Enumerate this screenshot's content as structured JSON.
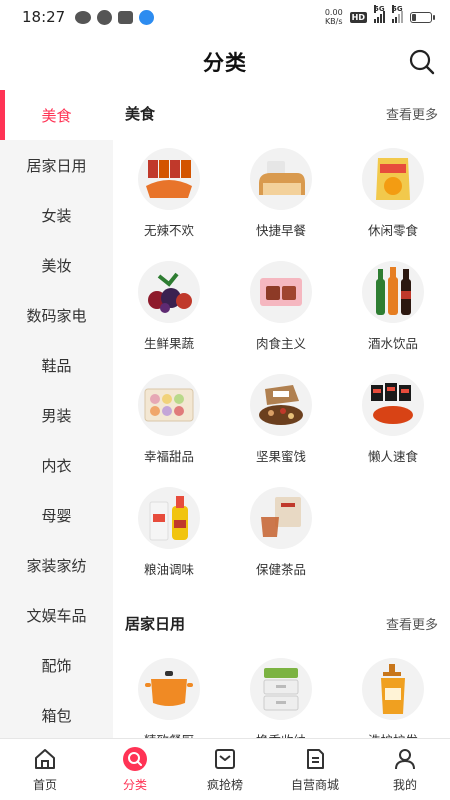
{
  "status_bar": {
    "time": "18:27",
    "net_speed_value": "0.00",
    "net_speed_unit": "KB/s",
    "hd_label": "HD",
    "signal1_label": "5G",
    "signal2_label": "5G",
    "battery_level": 0.25
  },
  "header": {
    "title": "分类",
    "search_icon": "search-icon"
  },
  "sidebar": {
    "active_index": 0,
    "items": [
      {
        "label": "美食"
      },
      {
        "label": "居家日用"
      },
      {
        "label": "女装"
      },
      {
        "label": "美妆"
      },
      {
        "label": "数码家电"
      },
      {
        "label": "鞋品"
      },
      {
        "label": "男装"
      },
      {
        "label": "内衣"
      },
      {
        "label": "母婴"
      },
      {
        "label": "家装家纺"
      },
      {
        "label": "文娱车品"
      },
      {
        "label": "配饰"
      },
      {
        "label": "箱包"
      }
    ]
  },
  "sections": [
    {
      "title": "美食",
      "more": "查看更多",
      "items": [
        {
          "label": "无辣不欢",
          "icon": "spicy-snack-image"
        },
        {
          "label": "快捷早餐",
          "icon": "bread-image"
        },
        {
          "label": "休闲零食",
          "icon": "chips-image"
        },
        {
          "label": "生鲜果蔬",
          "icon": "fruit-image"
        },
        {
          "label": "肉食主义",
          "icon": "meat-image"
        },
        {
          "label": "酒水饮品",
          "icon": "drinks-image"
        },
        {
          "label": "幸福甜品",
          "icon": "macaron-image"
        },
        {
          "label": "坚果蜜饯",
          "icon": "nuts-image"
        },
        {
          "label": "懒人速食",
          "icon": "instant-noodle-image"
        },
        {
          "label": "粮油调味",
          "icon": "rice-oil-image"
        },
        {
          "label": "保健茶品",
          "icon": "tea-image"
        }
      ]
    },
    {
      "title": "居家日用",
      "more": "查看更多",
      "items": [
        {
          "label": "精致餐厨",
          "icon": "cookware-image"
        },
        {
          "label": "换季收纳",
          "icon": "storage-image"
        },
        {
          "label": "洗护护发",
          "icon": "shampoo-image"
        }
      ]
    }
  ],
  "bottom_nav": {
    "active_index": 1,
    "items": [
      {
        "label": "首页",
        "icon": "home-icon"
      },
      {
        "label": "分类",
        "icon": "category-search-icon"
      },
      {
        "label": "疯抢榜",
        "icon": "ranking-icon"
      },
      {
        "label": "自营商城",
        "icon": "mall-icon"
      },
      {
        "label": "我的",
        "icon": "profile-icon"
      }
    ]
  },
  "colors": {
    "accent": "#ff3355",
    "sidebar_bg": "#f5f5f5"
  }
}
